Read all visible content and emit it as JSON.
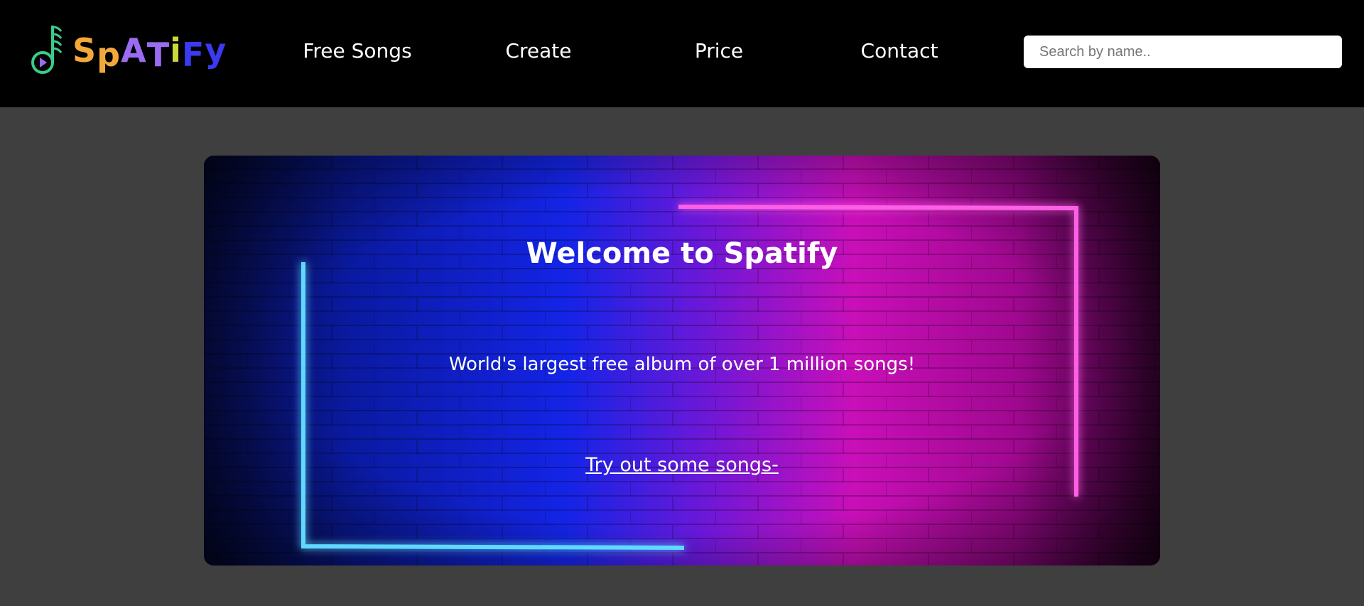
{
  "brand": {
    "name": "SpATiFy",
    "letters": [
      "S",
      "p",
      "A",
      "T",
      "i",
      "F",
      "y"
    ],
    "letter_colors": [
      "#f3a93a",
      "#f3a93a",
      "#9b6bf2",
      "#9b6bf2",
      "#c9d93a",
      "#3a3af0",
      "#3a3af0"
    ],
    "icon": "music-note-play-icon"
  },
  "nav": {
    "items": [
      "Free Songs",
      "Create",
      "Price",
      "Contact"
    ]
  },
  "search": {
    "placeholder": "Search by name.."
  },
  "hero": {
    "title": "Welcome to Spatify",
    "subtitle": "World's largest free album of over 1 million songs!",
    "cta": "Try out some songs-"
  },
  "colors": {
    "navbar": "#000000",
    "page": "#3f3f3f",
    "neon_blue": "#5fd9ff",
    "neon_pink": "#ff4fe0"
  }
}
